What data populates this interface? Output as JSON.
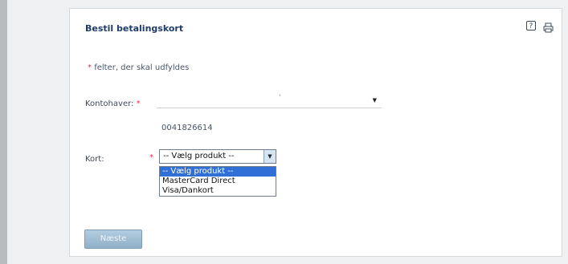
{
  "panel": {
    "title": "Bestil betalingskort",
    "icons": {
      "help": "help-icon",
      "print": "print-icon"
    }
  },
  "form": {
    "required_marker": "*",
    "required_note": "felter, der skal udfyldes",
    "kontohaver": {
      "label": "Kontohaver:",
      "selected_value": "",
      "tick_text": "'"
    },
    "account_number": "0041826614",
    "kort": {
      "label": "Kort:",
      "selected_value": "-- Vælg produkt --",
      "options": [
        "-- Vælg produkt --",
        "MasterCard Direct",
        "Visa/Dankort"
      ],
      "highlighted_index": 0
    },
    "submit_label": "Næste"
  },
  "colors": {
    "accent": "#1f3c66",
    "required": "#e2354a",
    "highlight": "#2f6fd6",
    "button": "#9fbcd2"
  }
}
